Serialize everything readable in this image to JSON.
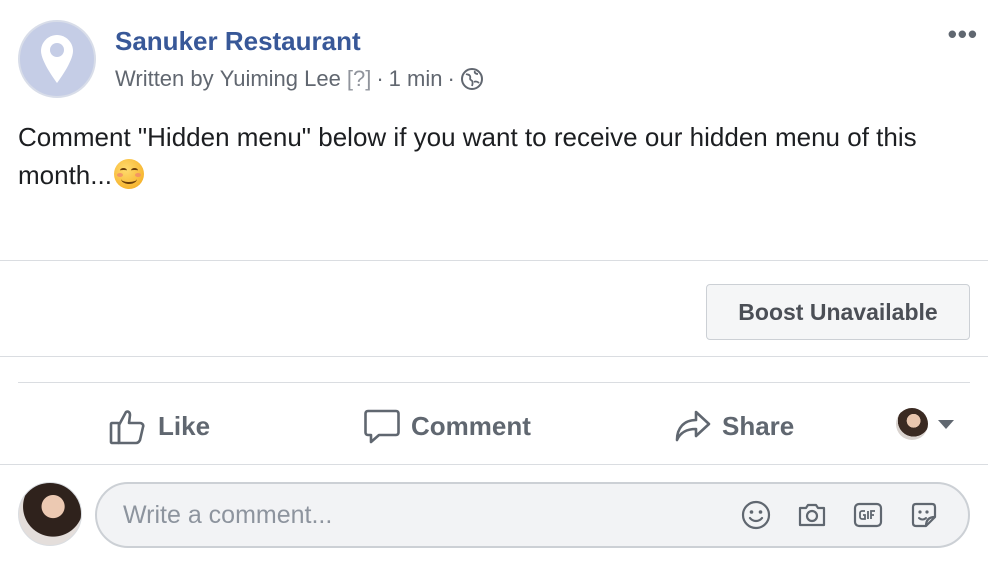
{
  "post": {
    "page_name": "Sanuker Restaurant",
    "author_prefix": "Written by",
    "author_name": "Yuiming Lee",
    "author_help": "[?]",
    "separator": "·",
    "time": "1 min",
    "privacy_icon": "globe-icon",
    "more_label": "•••",
    "text": "Comment \"Hidden menu\" below if you want to receive our hidden menu of this month..."
  },
  "boost": {
    "label": "Boost Unavailable"
  },
  "actions": {
    "like": "Like",
    "comment": "Comment",
    "share": "Share"
  },
  "composer": {
    "placeholder": "Write a comment...",
    "icons": [
      "emoji-icon",
      "camera-icon",
      "gif-icon",
      "sticker-icon"
    ]
  },
  "colors": {
    "link": "#385898",
    "secondary_text": "#616770",
    "action_text": "#606770",
    "divider": "#dadde1"
  }
}
